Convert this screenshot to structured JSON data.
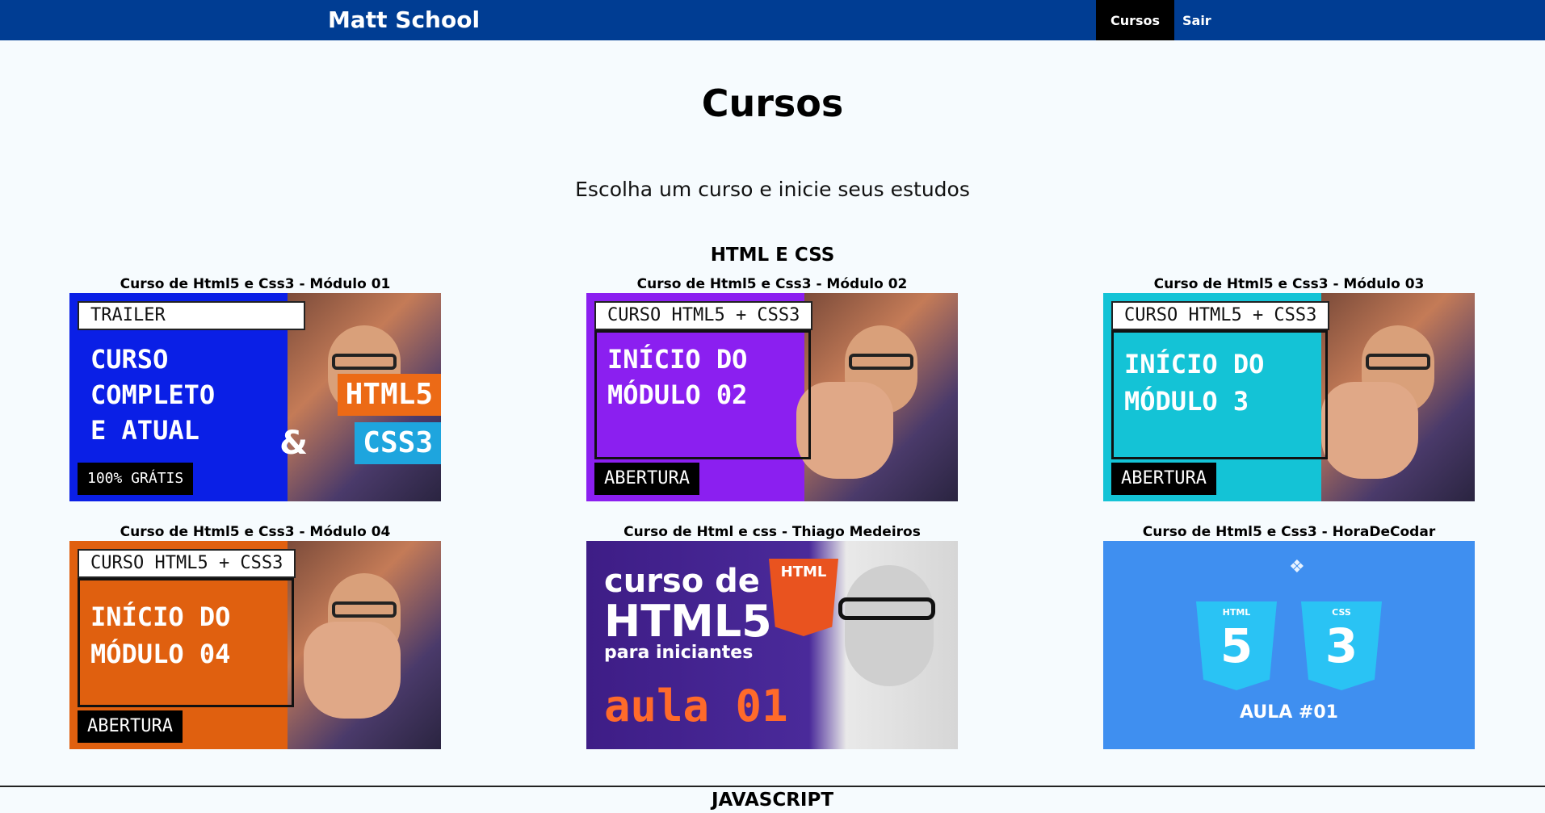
{
  "header": {
    "brand": "Matt School",
    "nav": [
      {
        "label": "Cursos",
        "active": true
      },
      {
        "label": "Sair",
        "active": false
      }
    ],
    "bg_color": "#003d93"
  },
  "main": {
    "title": "Cursos",
    "subtitle": "Escolha um curso e inicie seus estudos",
    "sections": [
      {
        "title": "HTML E CSS",
        "courses": [
          {
            "title": "Curso de Html5 e Css3 - Módulo 01",
            "thumb": {
              "tag": "TRAILER",
              "line1": "CURSO",
              "line2": "COMPLETO",
              "line3": "E ATUAL",
              "bottom": "100% GRÁTIS",
              "html": "HTML5",
              "css": "CSS3",
              "amp": "&",
              "color": "#0a1fe6"
            }
          },
          {
            "title": "Curso de Html5 e Css3 - Módulo 02",
            "thumb": {
              "tag": "CURSO HTML5 + CSS3",
              "line1": "INÍCIO DO",
              "line2": "MÓDULO 02",
              "bottom": "ABERTURA",
              "color": "#8b1ff0"
            }
          },
          {
            "title": "Curso de Html5 e Css3 - Módulo 03",
            "thumb": {
              "tag": "CURSO HTML5 + CSS3",
              "line1": "INÍCIO DO",
              "line2": "MÓDULO 3",
              "bottom": "ABERTURA",
              "color": "#14c3d6"
            }
          },
          {
            "title": "Curso de Html5 e Css3 - Módulo 04",
            "thumb": {
              "tag": "CURSO HTML5 + CSS3",
              "line1": "INÍCIO DO",
              "line2": "MÓDULO 04",
              "bottom": "ABERTURA",
              "color": "#e0600f"
            }
          },
          {
            "title": "Curso de Html e css - Thiago Medeiros",
            "thumb": {
              "line1": "curso de",
              "line2": "HTML5",
              "line3": "para iniciantes",
              "line4": "aula 01",
              "badge": "HTML",
              "color": "#3e1d86"
            }
          },
          {
            "title": "Curso de Html5 e Css3 - HoraDeCodar",
            "thumb": {
              "html_label": "HTML",
              "css_label": "CSS",
              "html_num": "5",
              "css_num": "3",
              "aula": "AULA #01",
              "color": "#3f8ff0"
            }
          }
        ]
      },
      {
        "title": "JAVASCRIPT"
      }
    ]
  }
}
